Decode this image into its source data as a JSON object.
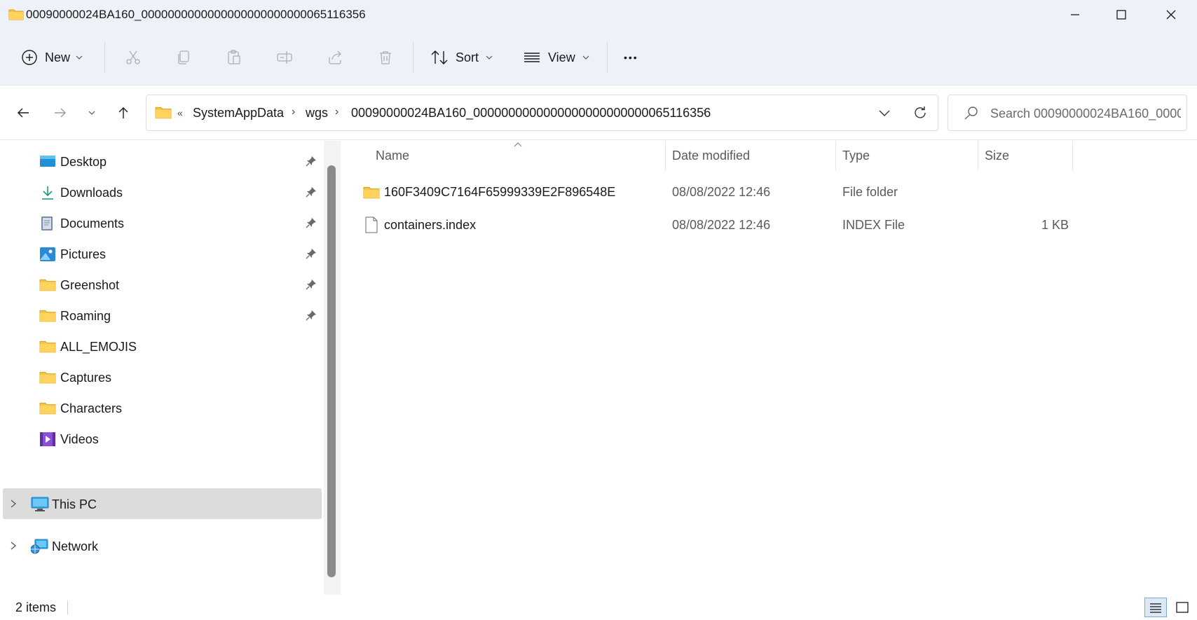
{
  "window": {
    "title": "00090000024BA160_0000000000000000000000000065116356"
  },
  "toolbar": {
    "new_label": "New",
    "sort_label": "Sort",
    "view_label": "View",
    "more_label": "•••"
  },
  "address": {
    "overflow": "«",
    "crumbs": [
      "SystemAppData",
      "wgs",
      "00090000024BA160_0000000000000000000000000065116356"
    ],
    "separator": "›"
  },
  "search": {
    "placeholder": "Search 00090000024BA160_0000..."
  },
  "sidebar": {
    "items": [
      {
        "label": "Desktop",
        "icon": "desktop-icon",
        "pinned": true
      },
      {
        "label": "Downloads",
        "icon": "download-icon",
        "pinned": true
      },
      {
        "label": "Documents",
        "icon": "documents-icon",
        "pinned": true
      },
      {
        "label": "Pictures",
        "icon": "pictures-icon",
        "pinned": true
      },
      {
        "label": "Greenshot",
        "icon": "folder-icon",
        "pinned": true
      },
      {
        "label": "Roaming",
        "icon": "folder-icon",
        "pinned": true
      },
      {
        "label": "ALL_EMOJIS",
        "icon": "folder-icon",
        "pinned": false
      },
      {
        "label": "Captures",
        "icon": "folder-icon",
        "pinned": false
      },
      {
        "label": "Characters",
        "icon": "folder-icon",
        "pinned": false
      },
      {
        "label": "Videos",
        "icon": "videos-icon",
        "pinned": false
      }
    ],
    "this_pc": "This PC",
    "network": "Network"
  },
  "columns": {
    "name": "Name",
    "date": "Date modified",
    "type": "Type",
    "size": "Size"
  },
  "files": [
    {
      "name": "160F3409C7164F65999339E2F896548E",
      "date": "08/08/2022 12:46",
      "type": "File folder",
      "size": "",
      "icon": "folder-icon"
    },
    {
      "name": "containers.index",
      "date": "08/08/2022 12:46",
      "type": "INDEX File",
      "size": "1 KB",
      "icon": "file-icon"
    }
  ],
  "status": {
    "count": "2 items"
  },
  "colors": {
    "folder": "#f5c443",
    "chrome": "#eef2f8",
    "selection": "#dcdcdc"
  }
}
